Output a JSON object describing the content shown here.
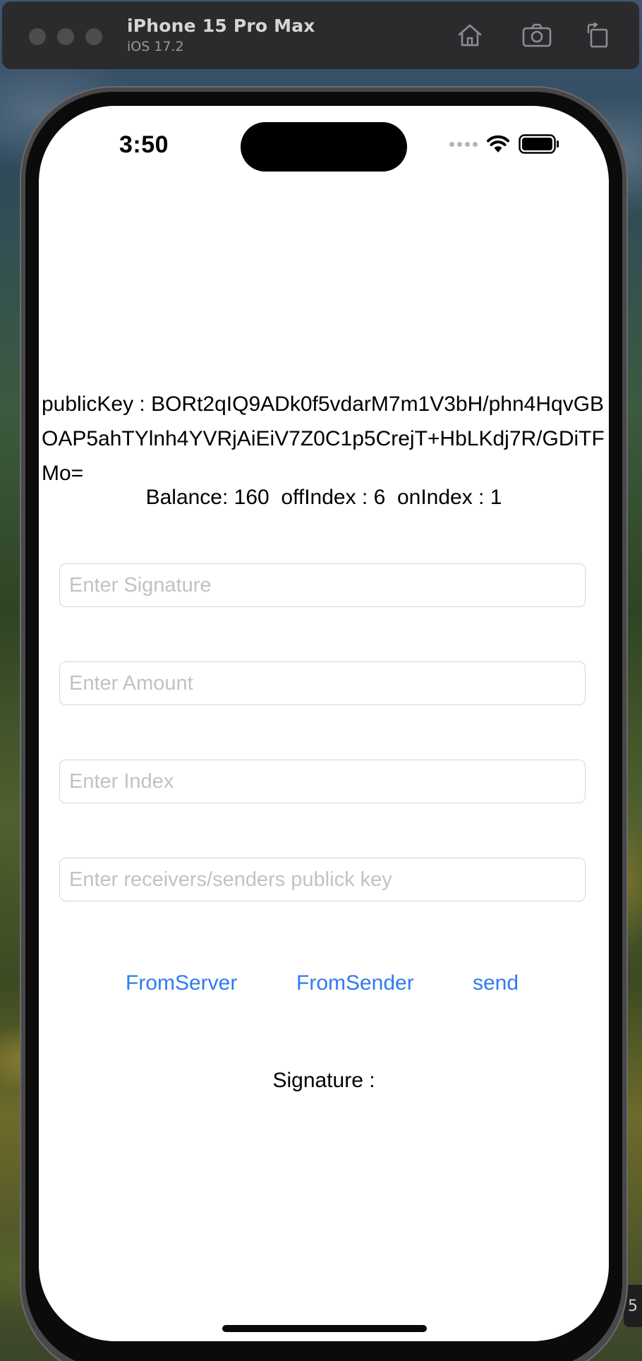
{
  "simulator": {
    "device_name": "iPhone 15 Pro Max",
    "os_version": "iOS 17.2",
    "side_badge": "5"
  },
  "status_bar": {
    "time": "3:50"
  },
  "app": {
    "public_key_text": "publicKey : BORt2qIQ9ADk0f5vdarM7m1V3bH/phn4HqvGBOAP5ahTYlnh4YVRjAiEiV7Z0C1p5CrejT+HbLKdj7R/GDiTFMo=",
    "balance_line": "Balance: 160  offIndex : 6  onIndex : 1",
    "fields": {
      "signature_placeholder": "Enter Signature",
      "amount_placeholder": "Enter Amount",
      "index_placeholder": "Enter Index",
      "pubkey_placeholder": "Enter receivers/senders publick key"
    },
    "buttons": {
      "from_server": "FromServer",
      "from_sender": "FromSender",
      "send": "send"
    },
    "signature_label": "Signature :"
  },
  "colors": {
    "link": "#2f7bf0",
    "placeholder": "#c2c2c6",
    "field_border": "#d6d6d6"
  }
}
